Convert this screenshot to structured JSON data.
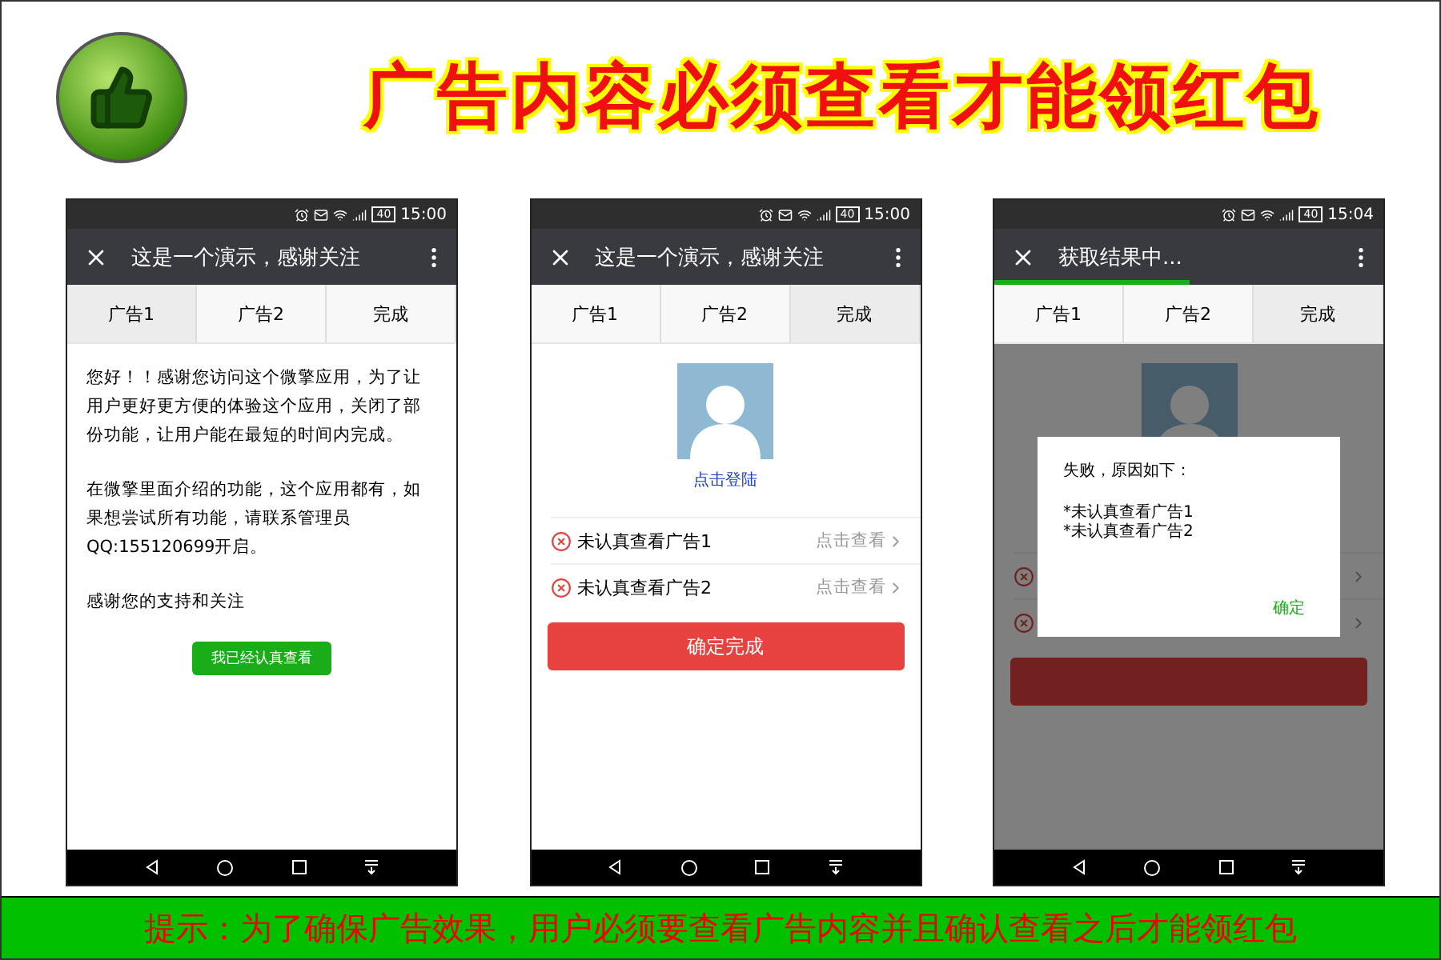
{
  "banner": {
    "title": "广告内容必须查看才能领红包"
  },
  "phones": [
    {
      "kind": "notice",
      "time": "15:00",
      "battery": "40",
      "title": "这是一个演示，感谢关注",
      "tabs": [
        {
          "label": "广告1",
          "selected": true
        },
        {
          "label": "广告2",
          "selected": false
        },
        {
          "label": "完成",
          "selected": false
        }
      ],
      "paragraphs": [
        "您好！！感谢您访问这个微擎应用，为了让用户更好更方便的体验这个应用，关闭了部份功能，让用户能在最短的时间内完成。",
        "在微擎里面介绍的功能，这个应用都有，如果想尝试所有功能，请联系管理员QQ:155120699开启。",
        "感谢您的支持和关注"
      ],
      "button": "我已经认真查看"
    },
    {
      "kind": "result",
      "time": "15:00",
      "battery": "40",
      "title": "这是一个演示，感谢关注",
      "tabs": [
        {
          "label": "广告1",
          "selected": false
        },
        {
          "label": "广告2",
          "selected": false
        },
        {
          "label": "完成",
          "selected": true
        }
      ],
      "login": "点击登陆",
      "rows": [
        {
          "text": "未认真查看广告1",
          "action": "点击查看"
        },
        {
          "text": "未认真查看广告2",
          "action": "点击查看"
        }
      ],
      "button": "确定完成"
    },
    {
      "kind": "dialog",
      "time": "15:04",
      "battery": "40",
      "title": "获取结果中...",
      "progress": {
        "level": 0.5
      },
      "tabs": [
        {
          "label": "广告1",
          "selected": false
        },
        {
          "label": "广告2",
          "selected": false
        },
        {
          "label": "完成",
          "selected": true
        }
      ],
      "dialog": {
        "title": "失败，原因如下：",
        "lines": [
          "*未认真查看广告1",
          "*未认真查看广告2"
        ],
        "button": "确定"
      }
    }
  ],
  "footer": "提示：为了确保广告效果，用户必须要查看广告内容并且确认查看之后才能领红包"
}
